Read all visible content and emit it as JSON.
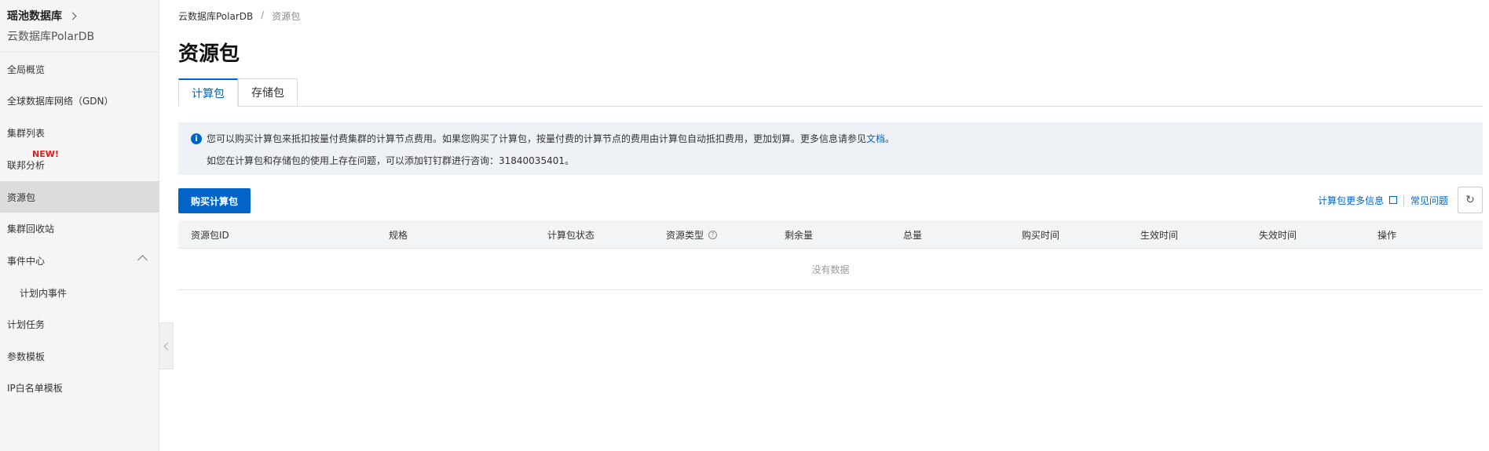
{
  "sidebar": {
    "title": "瑶池数据库",
    "subtitle": "云数据库PolarDB",
    "items": [
      {
        "label": "全局概览"
      },
      {
        "label": "全球数据库网络（GDN）"
      },
      {
        "label": "集群列表"
      },
      {
        "label": "联邦分析",
        "badge": "NEW!"
      },
      {
        "label": "资源包"
      },
      {
        "label": "集群回收站"
      },
      {
        "label": "事件中心"
      },
      {
        "label": "计划内事件"
      },
      {
        "label": "计划任务"
      },
      {
        "label": "参数模板"
      },
      {
        "label": "IP白名单模板"
      }
    ]
  },
  "breadcrumb": {
    "root": "云数据库PolarDB",
    "separator": "/",
    "current": "资源包"
  },
  "page_title": "资源包",
  "tabs": [
    {
      "label": "计算包",
      "active": true
    },
    {
      "label": "存储包",
      "active": false
    }
  ],
  "notice": {
    "line1_prefix": "您可以购买计算包来抵扣按量付费集群的计算节点费用。如果您购买了计算包，按量付费的计算节点的费用由计算包自动抵扣费用，更加划算。更多信息请参见",
    "line1_link": "文档",
    "line1_suffix": "。",
    "line2": "如您在计算包和存储包的使用上存在问题，可以添加钉钉群进行咨询：31840035401。"
  },
  "actions": {
    "buy_label": "购买计算包",
    "more_info_label": "计算包更多信息",
    "faq_label": "常见问题",
    "refresh_icon": "refresh-icon"
  },
  "table": {
    "columns": [
      "资源包ID",
      "规格",
      "计算包状态",
      "资源类型",
      "剩余量",
      "总量",
      "购买时间",
      "生效时间",
      "失效时间",
      "操作"
    ],
    "empty_text": "没有数据"
  },
  "colors": {
    "accent": "#0064c8",
    "badge": "#e02020",
    "notice_bg": "#eef2f6"
  }
}
